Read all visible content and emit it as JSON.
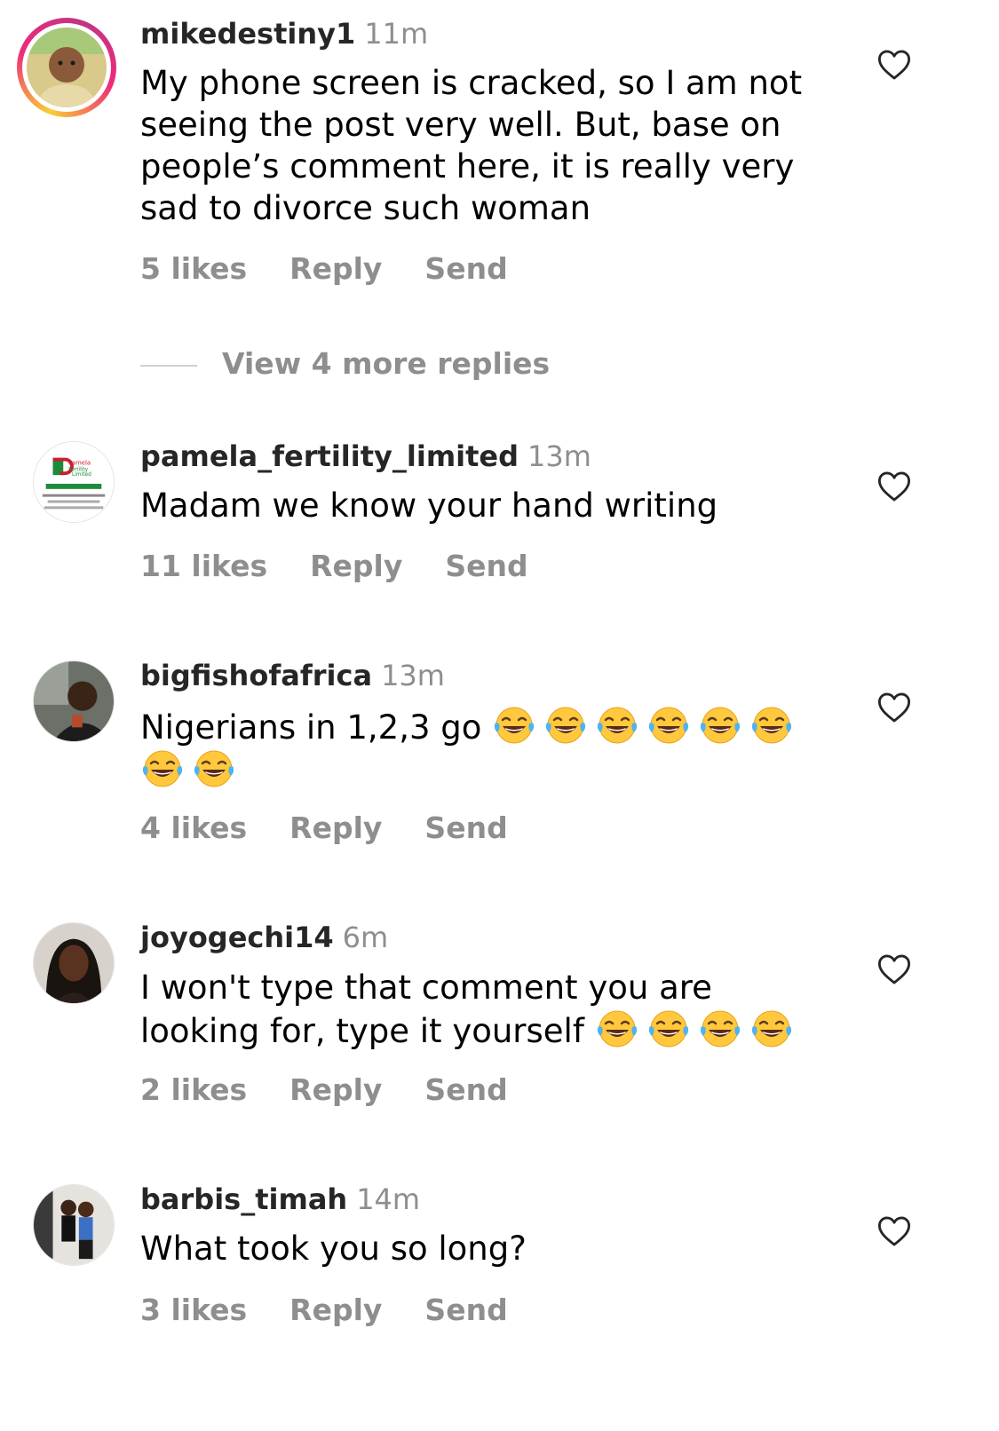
{
  "colors": {
    "text": "#000000",
    "username": "#262626",
    "meta": "#8e8e8e",
    "story_ring_start": "#f9ce34",
    "story_ring_end": "#c13584"
  },
  "view_more_replies": "View 4 more replies",
  "comments": [
    {
      "username": "mikedestiny1",
      "time": "11m",
      "text_lines": [
        "My phone screen is cracked, so I am not",
        "seeing the post very well. But, base on",
        "people’s comment here, it is really very",
        "sad to divorce such woman"
      ],
      "likes": "5 likes",
      "reply": "Reply",
      "send": "Send",
      "avatar_icon": "baby-photo-avatar",
      "has_story_ring": true
    },
    {
      "username": "pamela_fertility_limited",
      "time": "13m",
      "text_lines": [
        "Madam we know your hand writing"
      ],
      "likes": "11 likes",
      "reply": "Reply",
      "send": "Send",
      "avatar_icon": "business-logo-avatar",
      "avatar_logo_text": "Pamela Fertility Limited",
      "has_story_ring": false
    },
    {
      "username": "bigfishofafrica",
      "time": "13m",
      "text_line1": "Nigerians in 1,2,3 go",
      "emoji_icon": "face-with-tears-of-joy",
      "emoji_count_line1": 6,
      "emoji_count_line2": 2,
      "likes": "4 likes",
      "reply": "Reply",
      "send": "Send",
      "avatar_icon": "man-photo-avatar",
      "has_story_ring": false
    },
    {
      "username": "joyogechi14",
      "time": "6m",
      "text_line1": "I won't type that comment you are",
      "text_line2": "looking for, type it yourself",
      "emoji_icon": "face-with-tears-of-joy",
      "emoji_count_line2": 4,
      "likes": "2 likes",
      "reply": "Reply",
      "send": "Send",
      "avatar_icon": "woman-photo-avatar",
      "has_story_ring": false
    },
    {
      "username": "barbis_timah",
      "time": "14m",
      "text_lines": [
        "What took you so long?"
      ],
      "likes": "3 likes",
      "reply": "Reply",
      "send": "Send",
      "avatar_icon": "couple-photo-avatar",
      "has_story_ring": false
    }
  ]
}
